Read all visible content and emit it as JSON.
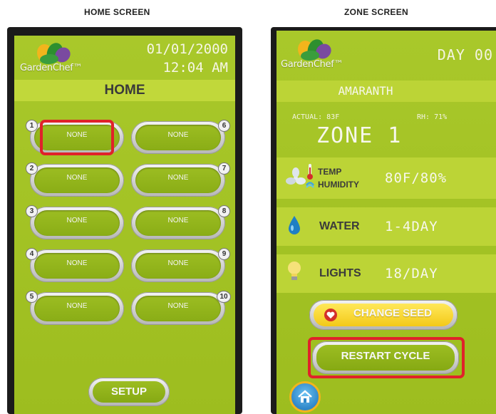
{
  "captions": {
    "left": "HOME SCREEN",
    "right": "ZONE SCREEN"
  },
  "brand": {
    "logo_text": "GardenChef",
    "tm": "™"
  },
  "home": {
    "date": "01/01/2000",
    "time": "12:04 AM",
    "title": "HOME",
    "zones": [
      {
        "number": "1",
        "label": "NONE"
      },
      {
        "number": "2",
        "label": "NONE"
      },
      {
        "number": "3",
        "label": "NONE"
      },
      {
        "number": "4",
        "label": "NONE"
      },
      {
        "number": "5",
        "label": "NONE"
      },
      {
        "number": "6",
        "label": "NONE"
      },
      {
        "number": "7",
        "label": "NONE"
      },
      {
        "number": "8",
        "label": "NONE"
      },
      {
        "number": "9",
        "label": "NONE"
      },
      {
        "number": "10",
        "label": "NONE"
      }
    ],
    "setup_label": "SETUP"
  },
  "zone": {
    "day": "DAY 00",
    "plant": "AMARANTH",
    "actual": "ACTUAL: 83F",
    "rh": "RH: 71%",
    "title": "ZONE 1",
    "temp_label": "TEMP",
    "humidity_label": "HUMIDITY",
    "temp_value": "80F/80%",
    "water_label": "WATER",
    "water_value": "1-4DAY",
    "lights_label": "LIGHTS",
    "lights_value": "18/DAY",
    "change_seed_label": "CHANGE SEED",
    "restart_label": "RESTART CYCLE"
  },
  "icons": {
    "fan": "fan-icon",
    "thermometer": "thermometer-icon",
    "humidity": "humidity-icon",
    "water": "water-drop-icon",
    "light": "light-bulb-icon",
    "heart": "heart-icon",
    "home": "home-icon"
  },
  "colors": {
    "screen_green": "#a9c82a",
    "bar_green": "#c1d83a",
    "highlight_red": "#e0222a",
    "home_ring_yellow": "#f2b51c",
    "seed_yellow": "#f3c919"
  }
}
